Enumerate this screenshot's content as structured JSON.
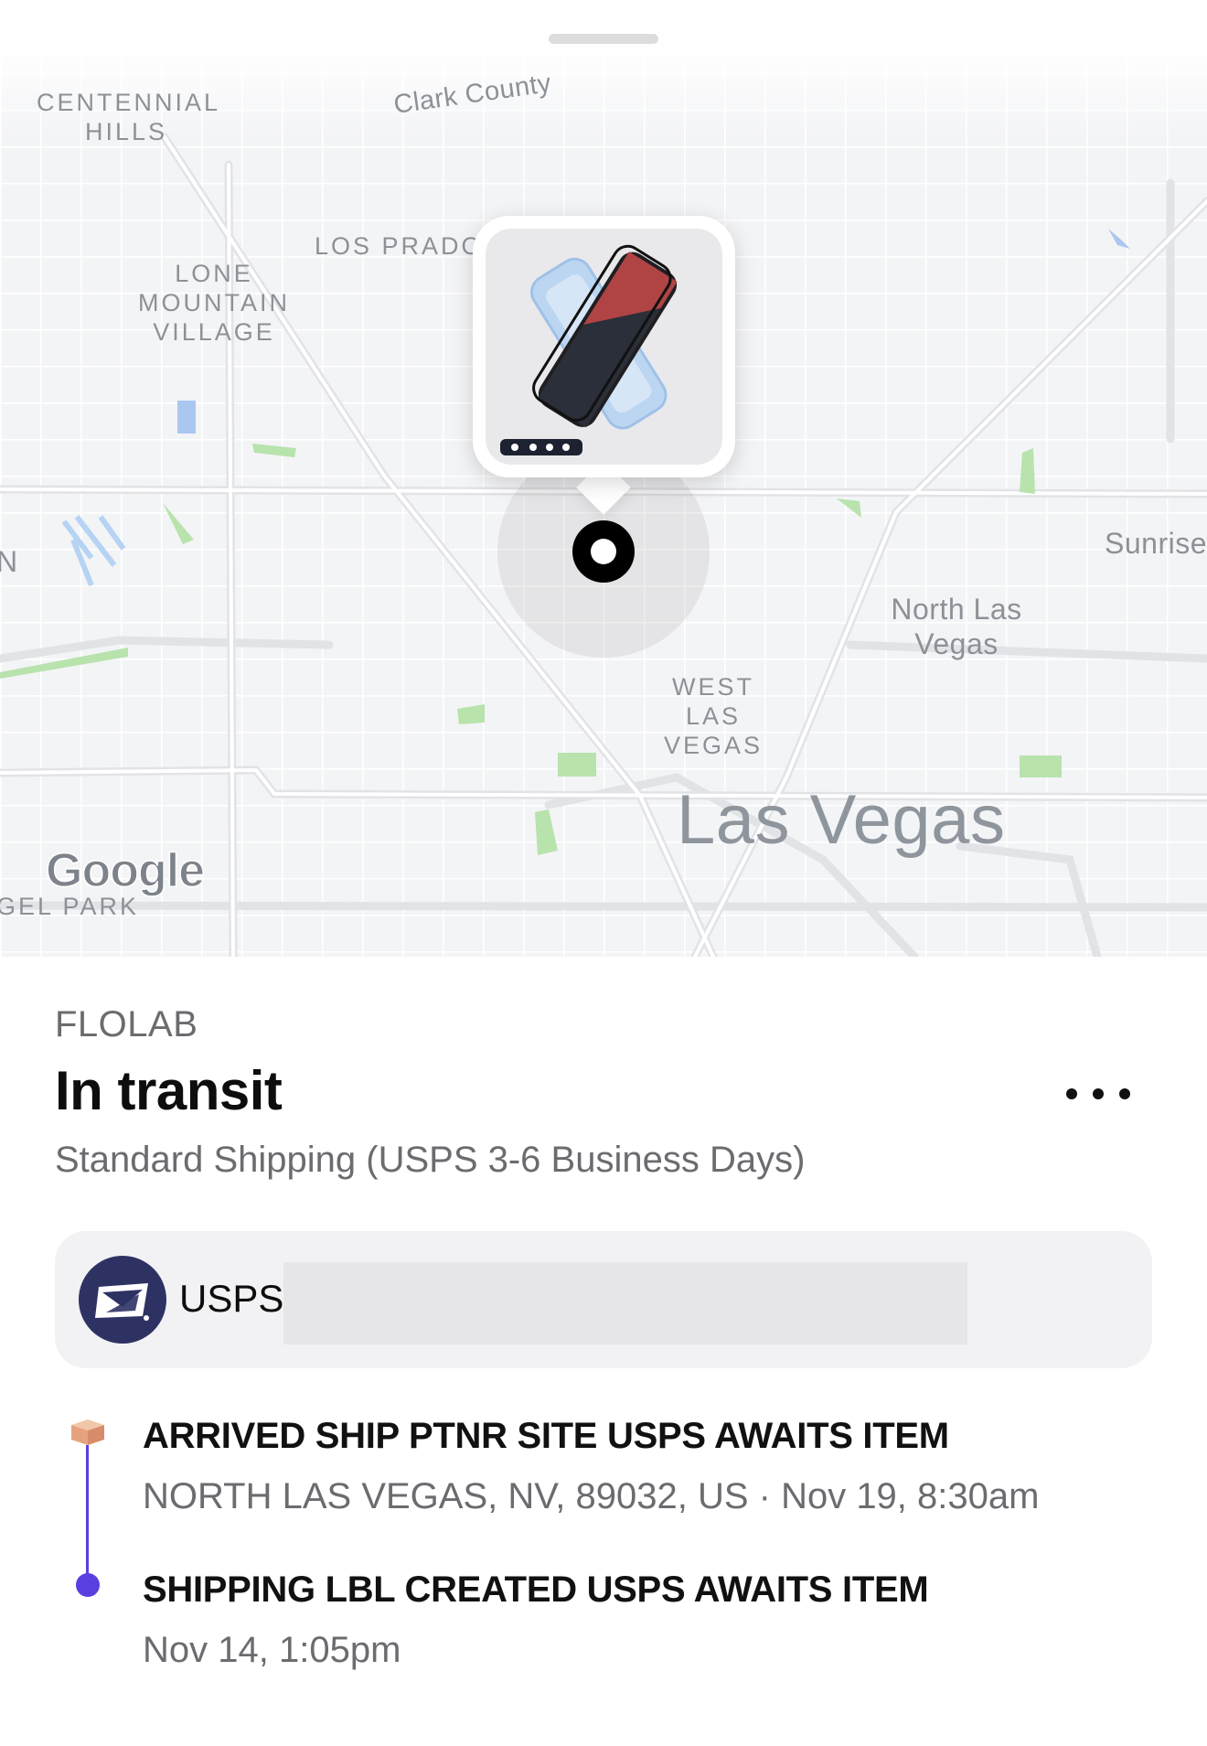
{
  "map": {
    "labels": {
      "centennial_hills": "CENTENNIAL HILLS",
      "clark_county": "Clark County",
      "los_prados": "LOS PRADOS",
      "lone_mountain_village": "LONE MOUNTAIN VILLAGE",
      "sunrise": "Sunrise",
      "north_las_vegas": "North Las Vegas",
      "west_las_vegas": "WEST LAS VEGAS",
      "las_vegas": "Las Vegas",
      "angel_park": "GEL PARK",
      "edge_n": "N"
    },
    "attribution": "Google",
    "product_image": "screen-protector-product-image"
  },
  "order": {
    "merchant": "FLOLAB",
    "status": "In transit",
    "shipping_method": "Standard Shipping (USPS 3-6 Business Days)",
    "more_icon": "more-horizontal-icon"
  },
  "carrier": {
    "name": "USPS",
    "logo": "usps-eagle-logo",
    "tracking_number": ""
  },
  "events": [
    {
      "title": "ARRIVED SHIP PTNR SITE USPS AWAITS ITEM",
      "detail": "NORTH LAS VEGAS, NV, 89032, US · Nov 19, 8:30am",
      "icon": "package-box-icon"
    },
    {
      "title": "SHIPPING LBL CREATED USPS AWAITS ITEM",
      "detail": "Nov 14, 1:05pm",
      "icon": "timeline-dot-icon"
    }
  ],
  "colors": {
    "accent": "#5A3FE0",
    "usps_blue": "#2E3263",
    "map_background": "#F3F4F6"
  }
}
